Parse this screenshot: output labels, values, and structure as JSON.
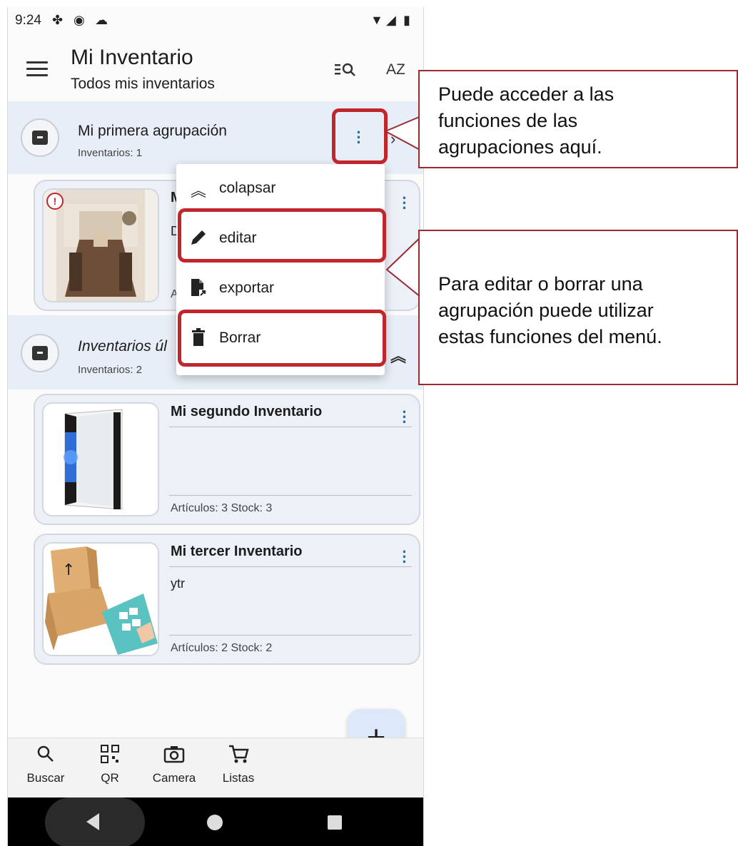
{
  "status_bar": {
    "time": "9:24"
  },
  "app_bar": {
    "title": "Mi Inventario",
    "subtitle": "Todos mis inventarios",
    "sort_icon_label": "AZ"
  },
  "groups": [
    {
      "title": "Mi primera agrupación",
      "count": "Inventarios: 1"
    },
    {
      "title": "Inventarios úl",
      "count": "Inventarios: 2"
    }
  ],
  "cards": [
    {
      "title": "M",
      "desc": "D",
      "stats": "A"
    },
    {
      "title": "Mi segundo Inventario",
      "desc": "",
      "stats": "Artículos: 3   Stock: 3"
    },
    {
      "title": "Mi tercer Inventario",
      "desc": "ytr",
      "stats": "Artículos: 2   Stock: 2"
    }
  ],
  "popup_menu": {
    "items": [
      {
        "label": "colapsar",
        "icon": "chevron-double-up-icon"
      },
      {
        "label": "editar",
        "icon": "pencil-icon"
      },
      {
        "label": "exportar",
        "icon": "file-export-icon"
      },
      {
        "label": "Borrar",
        "icon": "trash-icon"
      }
    ]
  },
  "bottom_nav": [
    {
      "label": "Buscar",
      "icon": "search-icon"
    },
    {
      "label": "QR",
      "icon": "qr-icon"
    },
    {
      "label": "Camera",
      "icon": "camera-icon"
    },
    {
      "label": "Listas",
      "icon": "cart-icon"
    }
  ],
  "fab": {
    "label": "+"
  },
  "callouts": [
    {
      "lines": [
        "Puede acceder a las",
        "funciones de las",
        "agrupaciones aquí."
      ]
    },
    {
      "lines": [
        "Para editar o borrar una",
        "agrupación puede utilizar",
        "estas funciones del menú."
      ]
    }
  ],
  "colors": {
    "highlight": "#c0262c",
    "callout_border": "#9b2a32",
    "accent": "#1d6fb8",
    "group_bg": "#e8eef7"
  }
}
